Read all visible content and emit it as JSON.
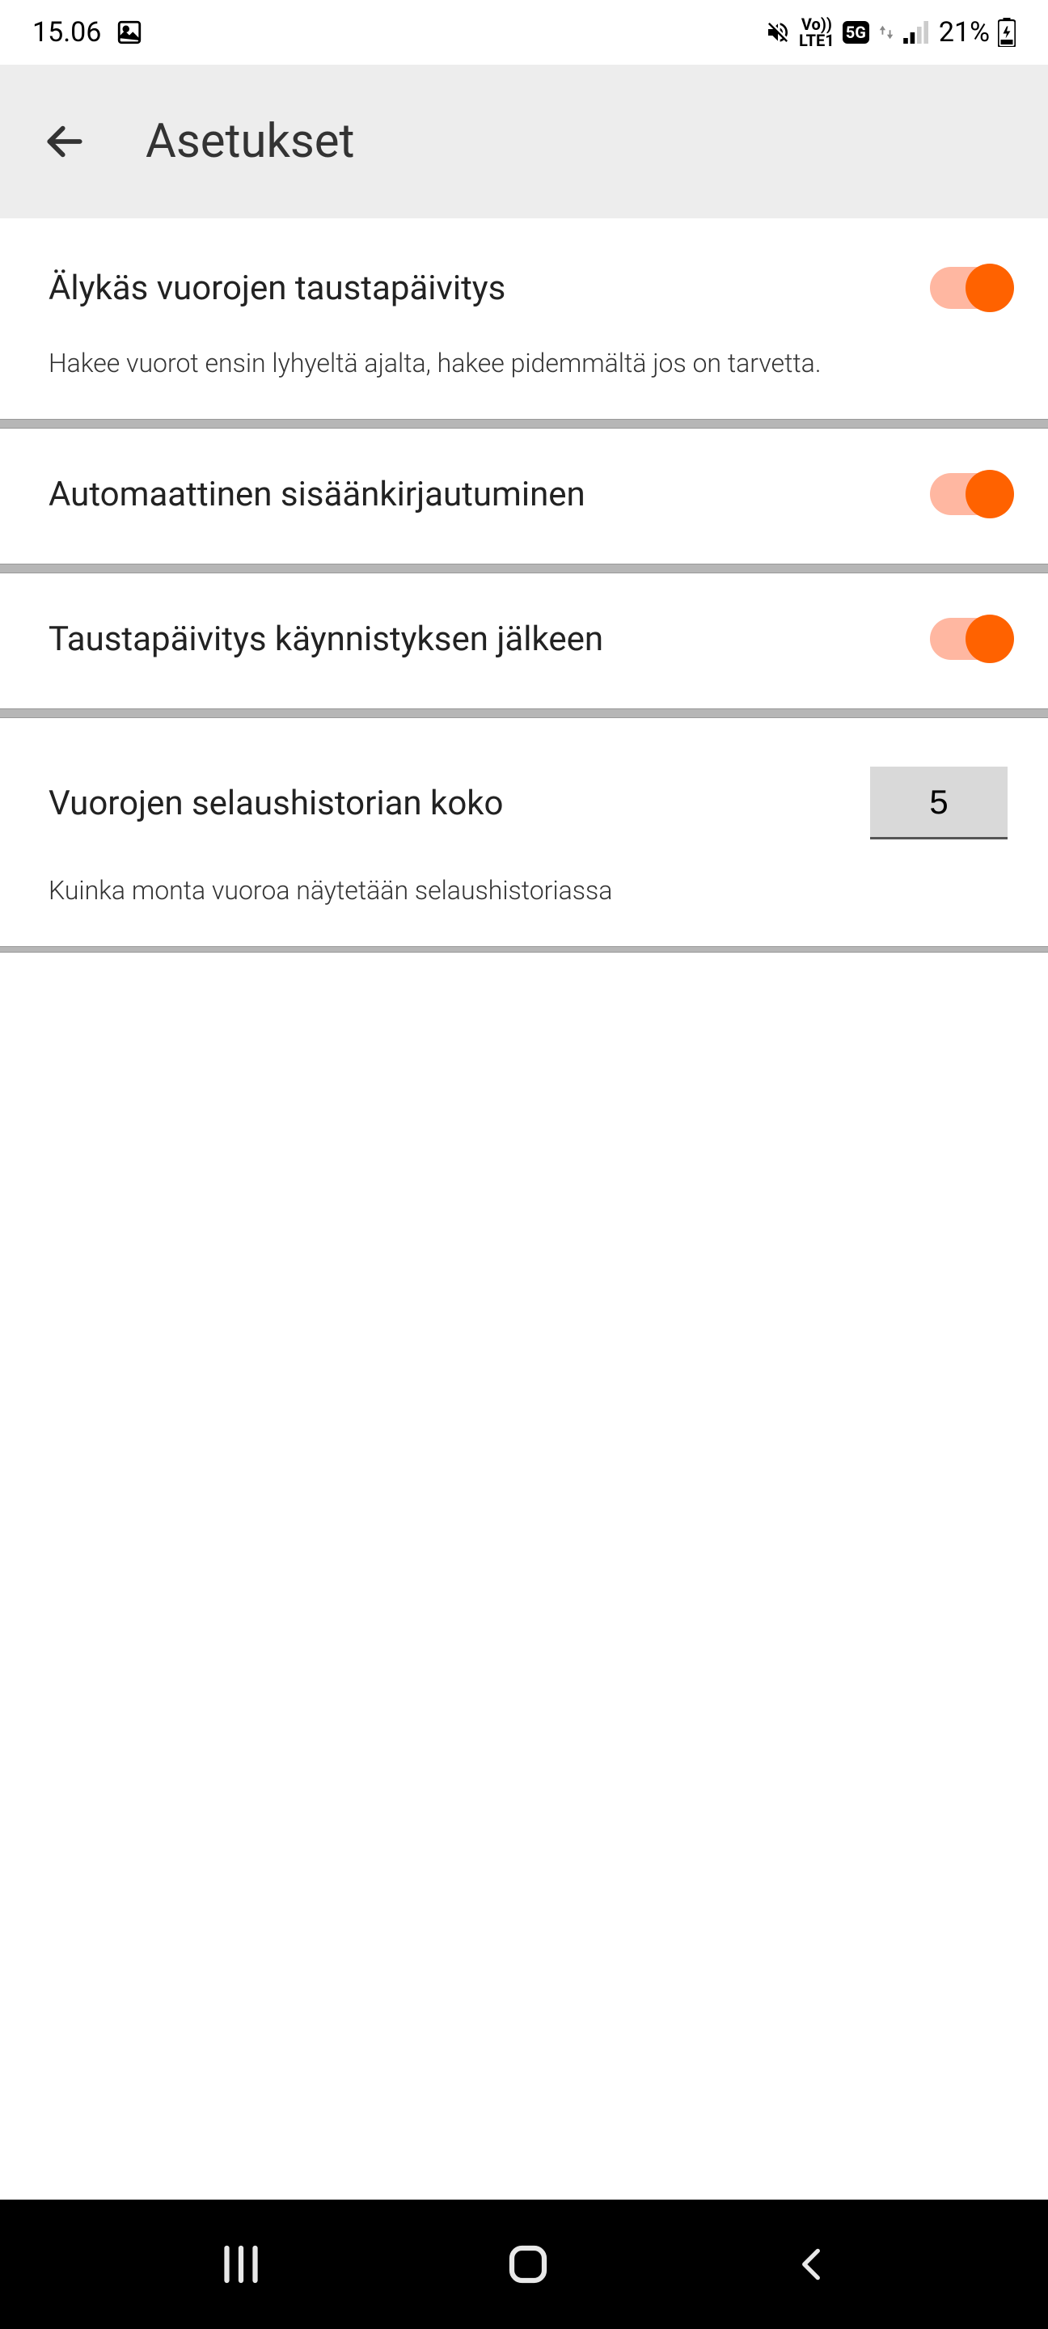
{
  "status": {
    "time": "15.06",
    "battery": "21%",
    "network_label_top": "Vo))",
    "network_label_bot": "LTE1",
    "network_badge": "5G"
  },
  "header": {
    "title": "Asetukset"
  },
  "settings": [
    {
      "title": "Älykäs vuorojen taustapäivitys",
      "description": "Hakee vuorot ensin lyhyeltä ajalta, hakee pidemmältä jos on tarvetta.",
      "type": "toggle",
      "value": true
    },
    {
      "title": "Automaattinen sisäänkirjautuminen",
      "type": "toggle",
      "value": true
    },
    {
      "title": "Taustapäivitys käynnistyksen jälkeen",
      "type": "toggle",
      "value": true
    },
    {
      "title": "Vuorojen selaushistorian koko",
      "description": "Kuinka monta vuoroa näytetään selaushistoriassa",
      "type": "number",
      "value": "5"
    }
  ]
}
